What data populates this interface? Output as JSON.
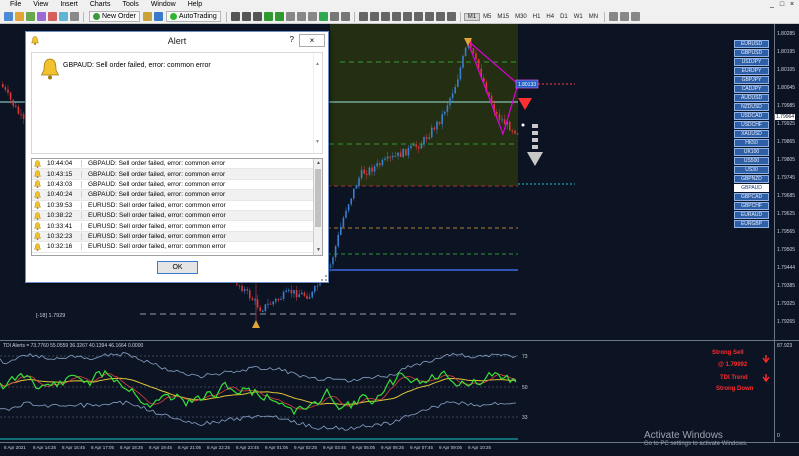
{
  "menu": {
    "items": [
      "File",
      "View",
      "Insert",
      "Charts",
      "Tools",
      "Window",
      "Help"
    ],
    "window_controls": [
      "_",
      "□",
      "×"
    ]
  },
  "toolbar": {
    "new_order_label": "New Order",
    "autotrading_label": "AutoTrading",
    "timeframes": [
      "M1",
      "M5",
      "M15",
      "M30",
      "H1",
      "H4",
      "D1",
      "W1",
      "MN"
    ],
    "active_timeframe": "M1"
  },
  "chart": {
    "cursor_label": "[-18] 1.7929",
    "price_tag": "1.80133",
    "y_ticks": [
      "1.80285",
      "1.80195",
      "1.80105",
      "1.80045",
      "1.79985",
      "1.79925",
      "1.79865",
      "1.79805",
      "1.79745",
      "1.79685",
      "1.79625",
      "1.79565",
      "1.79505",
      "1.79444",
      "1.79385",
      "1.79325",
      "1.79265"
    ],
    "current_price": "1.79964",
    "colors": {
      "background": "#0c1424",
      "zone": "#232e12",
      "bull": "#3a7fd0",
      "bear": "#d83a3a",
      "triangle": "#e000e0"
    }
  },
  "symbols": {
    "items": [
      "EURUSD",
      "GBPUSD",
      "USDJPY",
      "EURJPY",
      "GBPJPY",
      "CADJPY",
      "AUDUSD",
      "NZDUSD",
      "USDCAD",
      "USDCHF",
      "XAUUSD",
      "HK50",
      "UK100",
      "US500",
      "US30",
      "GBPNZD",
      "GBPAUD",
      "GBPCAD",
      "GBPCHF",
      "EURAUD",
      "EURGBP"
    ],
    "selected": "GBPAUD"
  },
  "indicator": {
    "label": "TDI Alerts = 73.7760 55.0559 36.3267 40.1394 46.1664 0.0000",
    "levels": [
      "73",
      "50",
      "33"
    ],
    "y_ticks": [
      "87.923",
      "0"
    ],
    "signals": {
      "line1": "Strong Sell",
      "line2": "@ 1.79992",
      "line3": "TDI Trend",
      "line4": "Strong Down"
    }
  },
  "x_axis": {
    "ticks": [
      "8 Apr 2021",
      "8 Apr 14:25",
      "8 Apr 15:45",
      "8 Apr 17:05",
      "8 Apr 18:25",
      "8 Apr 19:45",
      "8 Apr 21:05",
      "8 Apr 22:25",
      "8 Apr 23:45",
      "9 Apr 01:05",
      "9 Apr 02:25",
      "9 Apr 03:45",
      "9 Apr 05:05",
      "9 Apr 06:25",
      "9 Apr 07:45",
      "9 Apr 09:05",
      "9 Apr 10:25"
    ]
  },
  "alert": {
    "title": "Alert",
    "help": "?",
    "close": "×",
    "message": "GBPAUD: Sell order failed, error: common error",
    "rows": [
      {
        "time": "10:44:04",
        "message": "GBPAUD: Sell order failed, error: common error"
      },
      {
        "time": "10:43:15",
        "message": "GBPAUD: Sell order failed, error: common error"
      },
      {
        "time": "10:43:03",
        "message": "GBPAUD: Sell order failed, error: common error"
      },
      {
        "time": "10:40:24",
        "message": "GBPAUD: Sell order failed, error: common error"
      },
      {
        "time": "10:39:53",
        "message": "EURUSD: Sell order failed, error: common error"
      },
      {
        "time": "10:38:22",
        "message": "EURUSD: Sell order failed, error: common error"
      },
      {
        "time": "10:33:41",
        "message": "EURUSD: Sell order failed, error: common error"
      },
      {
        "time": "10:32:23",
        "message": "EURUSD: Sell order failed, error: common error"
      },
      {
        "time": "10:32:16",
        "message": "EURUSD: Sell order failed, error: common error"
      }
    ],
    "ok_label": "OK"
  },
  "watermark": {
    "line1": "Activate Windows",
    "line2": "Go to PC settings to activate Windows."
  }
}
